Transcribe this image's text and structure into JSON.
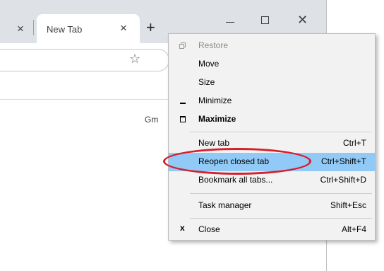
{
  "tabs": {
    "previous_tab_close": "×",
    "active_tab_title": "New Tab",
    "active_tab_close": "×",
    "new_tab_symbol": "+"
  },
  "window_controls": {
    "close_symbol": "✕"
  },
  "toolbar": {
    "bookmark_star": "☆"
  },
  "page": {
    "gmail_partial": "Gm"
  },
  "system_menu": {
    "items": [
      {
        "label": "Restore",
        "shortcut": "",
        "icon": "restore-icon",
        "disabled": true
      },
      {
        "label": "Move",
        "shortcut": ""
      },
      {
        "label": "Size",
        "shortcut": ""
      },
      {
        "label": "Minimize",
        "shortcut": "",
        "icon": "minimize-icon"
      },
      {
        "label": "Maximize",
        "shortcut": "",
        "icon": "maximize-icon",
        "bold": true
      },
      {
        "label": "New tab",
        "shortcut": "Ctrl+T"
      },
      {
        "label": "Reopen closed tab",
        "shortcut": "Ctrl+Shift+T",
        "highlighted": true
      },
      {
        "label": "Bookmark all tabs...",
        "shortcut": "Ctrl+Shift+D"
      },
      {
        "label": "Task manager",
        "shortcut": "Shift+Esc"
      },
      {
        "label": "Close",
        "shortcut": "Alt+F4",
        "icon": "close-icon"
      }
    ]
  },
  "colors": {
    "highlight": "#91c9f7",
    "annotation": "#d61f2c",
    "tabstrip": "#dee1e6"
  }
}
